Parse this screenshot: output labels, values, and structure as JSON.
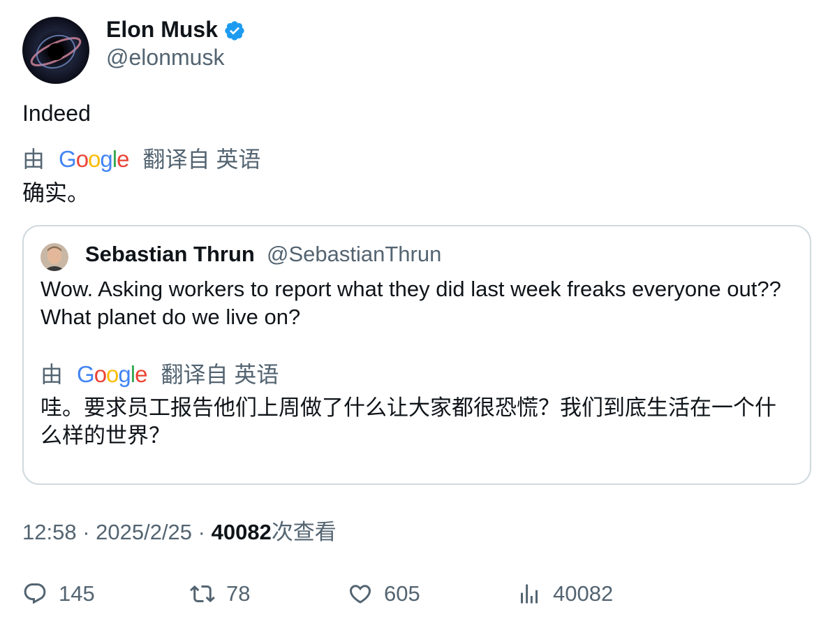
{
  "author": {
    "name": "Elon Musk",
    "handle": "@elonmusk"
  },
  "tweet": {
    "text": "Indeed",
    "translated_text": "确实。"
  },
  "translation": {
    "prefix": "由",
    "suffix": "翻译自 英语"
  },
  "quote": {
    "name": "Sebastian Thrun",
    "handle": "@SebastianThrun",
    "text": "Wow. Asking workers to report what they did last week freaks everyone out?? What planet do we live on?",
    "translated_text": "哇。要求员工报告他们上周做了什么让大家都很恐慌？我们到底生活在一个什么样的世界？"
  },
  "meta": {
    "time_date": "12:58 · 2025/2/25 · ",
    "views": "40082",
    "views_suffix": "次查看"
  },
  "actions": {
    "replies": "145",
    "retweets": "78",
    "likes": "605",
    "views": "40082"
  },
  "colors": {
    "text": "#0f1419",
    "secondary": "#536471",
    "verified": "#1d9bf0",
    "border": "#cfd9de"
  },
  "icons": [
    "verified-badge-icon",
    "google-logo",
    "reply-icon",
    "retweet-icon",
    "like-icon",
    "views-icon"
  ]
}
